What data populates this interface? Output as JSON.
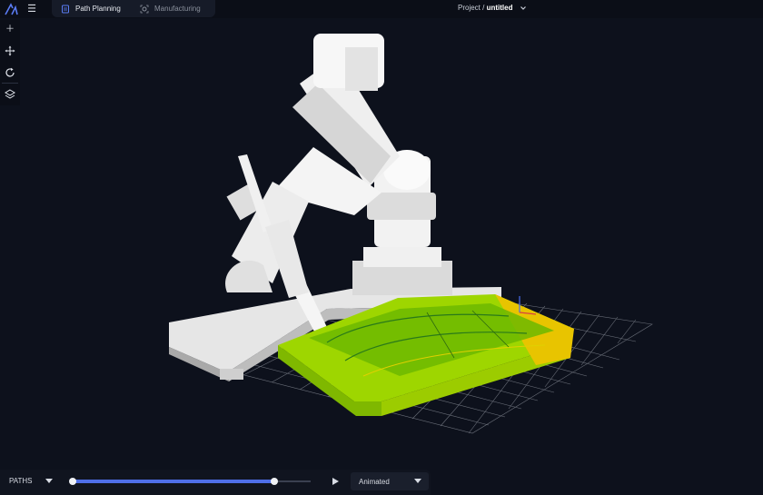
{
  "header": {
    "tabs": [
      {
        "label": "Path Planning",
        "active": true,
        "icon": "document-icon"
      },
      {
        "label": "Manufacturing",
        "active": false,
        "icon": "camera-settings-icon"
      }
    ],
    "project_prefix": "Project /",
    "project_name": "untitled"
  },
  "toolbar": {
    "tools": [
      "add-icon",
      "move-icon",
      "rotate-icon",
      "layers-icon"
    ]
  },
  "scene": {
    "robot_color": "#f2f2f2",
    "base_color": "#e8e8e8",
    "grid_color": "#8a8f99",
    "toolpath_colors": [
      "#b8e000",
      "#7ac400",
      "#e8d000",
      "#f0b000"
    ]
  },
  "bottom": {
    "paths_label": "PATHS",
    "slider_start": 0.0,
    "slider_end": 0.85,
    "mode_label": "Animated"
  },
  "colors": {
    "background": "#0d111c",
    "accent": "#4f6fe8",
    "panel": "#161b28"
  }
}
